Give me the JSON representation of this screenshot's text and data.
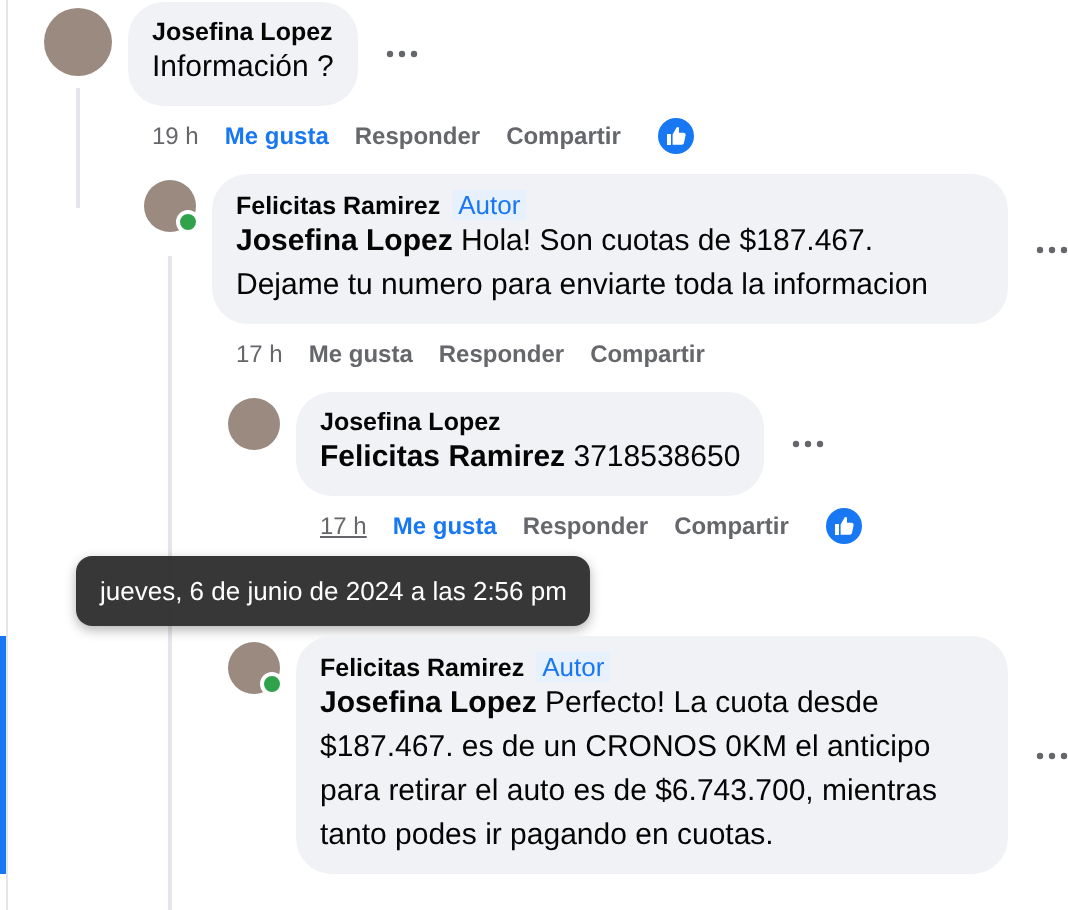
{
  "comments": [
    {
      "author": "Josefina Lopez",
      "online": false,
      "text": "Información ?",
      "time": "19 h",
      "like_label": "Me gusta",
      "liked": true,
      "reply_label": "Responder",
      "share_label": "Compartir",
      "reactions": true,
      "children": [
        {
          "author": "Felicitas Ramirez",
          "badge": "Autor",
          "online": true,
          "mention": "Josefina Lopez",
          "text": "Hola! Son cuotas de $187.467. Dejame tu numero para enviarte toda la informacion",
          "time": "17 h",
          "like_label": "Me gusta",
          "liked": false,
          "reply_label": "Responder",
          "share_label": "Compartir",
          "reactions": false,
          "children": [
            {
              "author": "Josefina Lopez",
              "online": false,
              "mention": "Felicitas Ramirez",
              "text": "3718538650",
              "time": "17 h",
              "time_hovered": true,
              "like_label": "Me gusta",
              "liked": true,
              "reply_label": "Responder",
              "share_label": "Compartir",
              "reactions": true,
              "tooltip": "jueves, 6 de junio de 2024 a las 2:56 pm"
            },
            {
              "author": "Felicitas Ramirez",
              "badge": "Autor",
              "online": true,
              "highlighted": true,
              "mention": "Josefina Lopez",
              "text": "Perfecto! La cuota desde $187.467. es de un CRONOS 0KM el anticipo para retirar el auto es de $6.743.700, mientras tanto podes ir pagando en cuotas."
            }
          ]
        }
      ]
    }
  ]
}
